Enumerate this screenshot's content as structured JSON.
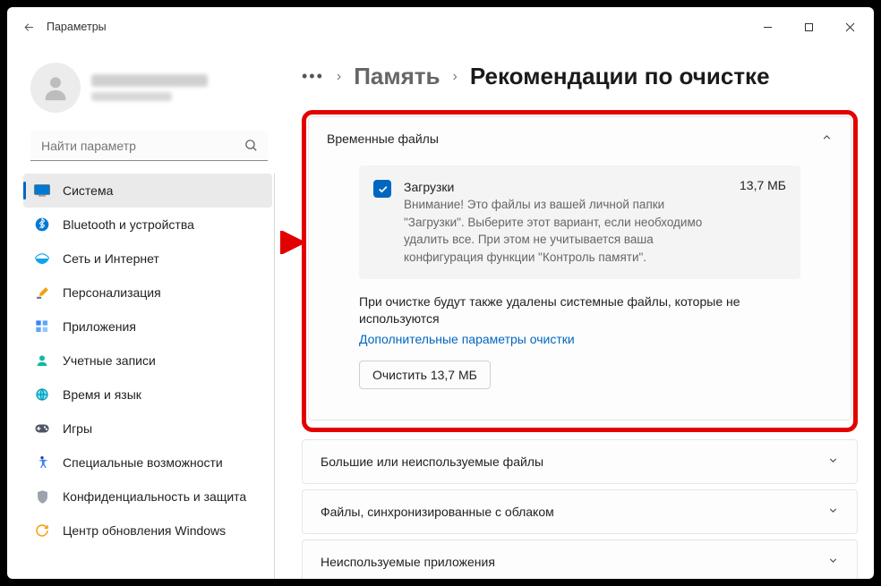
{
  "titlebar": {
    "title": "Параметры"
  },
  "search": {
    "placeholder": "Найти параметр"
  },
  "nav": {
    "items": [
      {
        "label": "Система"
      },
      {
        "label": "Bluetooth и устройства"
      },
      {
        "label": "Сеть и Интернет"
      },
      {
        "label": "Персонализация"
      },
      {
        "label": "Приложения"
      },
      {
        "label": "Учетные записи"
      },
      {
        "label": "Время и язык"
      },
      {
        "label": "Игры"
      },
      {
        "label": "Специальные возможности"
      },
      {
        "label": "Конфиденциальность и защита"
      },
      {
        "label": "Центр обновления Windows"
      }
    ]
  },
  "breadcrumb": {
    "storage": "Память",
    "current": "Рекомендации по очистке"
  },
  "panels": {
    "temp": {
      "title": "Временные файлы",
      "downloads": {
        "title": "Загрузки",
        "size": "13,7 МБ",
        "desc": "Внимание! Это файлы из вашей личной папки \"Загрузки\". Выберите этот вариант, если необходимо удалить все. При этом не учитывается ваша конфигурация функции \"Контроль памяти\"."
      },
      "info": "При очистке будут также удалены системные файлы, которые не используются",
      "link": "Дополнительные параметры очистки",
      "button": "Очистить 13,7 МБ"
    },
    "large": {
      "title": "Большие или неиспользуемые файлы"
    },
    "cloud": {
      "title": "Файлы, синхронизированные с облаком"
    },
    "unused": {
      "title": "Неиспользуемые приложения"
    }
  }
}
